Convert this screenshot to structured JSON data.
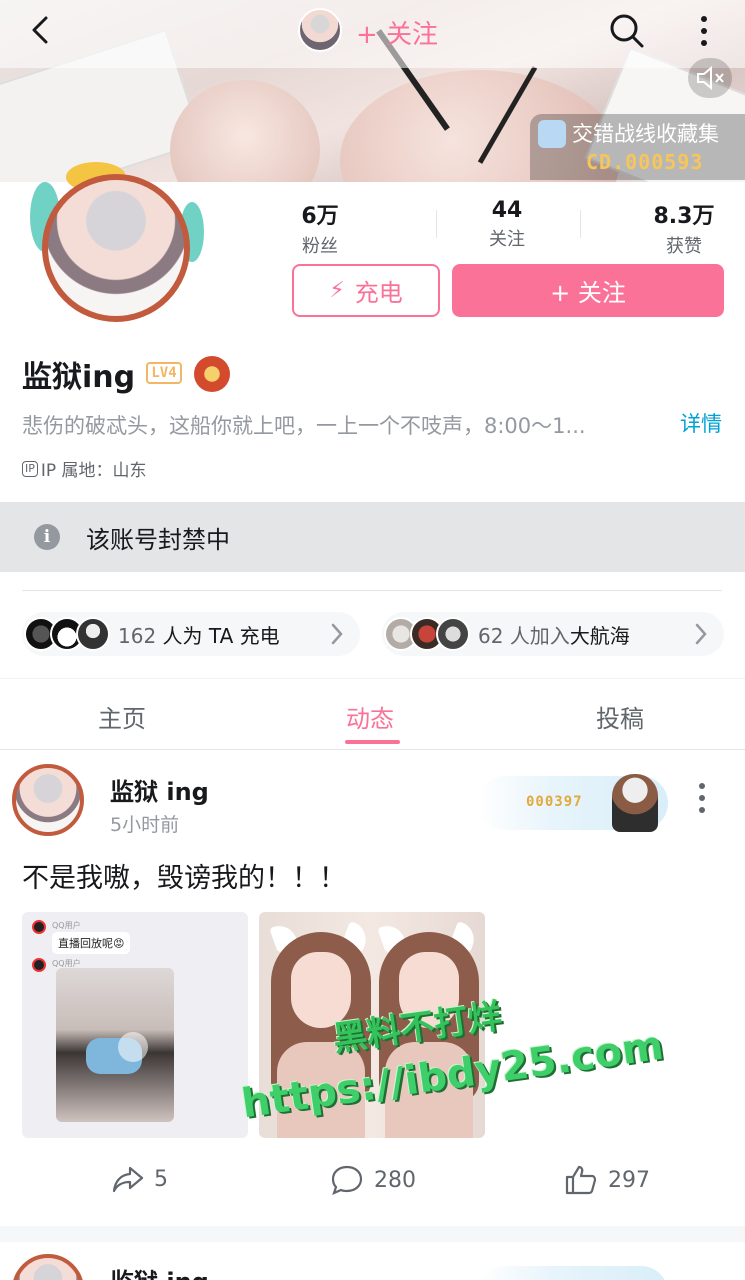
{
  "header": {
    "top_follow_label": "+ 关注",
    "collection_name": "交错战线收藏集",
    "collection_no": "CD.000593"
  },
  "profile": {
    "stats": [
      {
        "value": "6万",
        "label": "粉丝"
      },
      {
        "value": "44",
        "label": "关注"
      },
      {
        "value": "8.3万",
        "label": "获赞"
      }
    ],
    "charge_label": "充电",
    "follow_label": "+ 关注",
    "username": "监狱ing",
    "level": "LV4",
    "bio": "悲伤的破忒头，这船你就上吧，一上一个不吱声，8:00～1...",
    "detail_label": "详情",
    "ip_icon": "IP",
    "ip_text": "IP 属地：山东"
  },
  "ban_notice": {
    "icon": "i",
    "text": "该账号封禁中"
  },
  "supporters": {
    "charge": {
      "count": "162",
      "text": "人为 TA 充电"
    },
    "fleet": {
      "count": "62",
      "text": "人加入",
      "highlight": "大航海"
    }
  },
  "tabs": [
    {
      "label": "主页"
    },
    {
      "label": "动态"
    },
    {
      "label": "投稿"
    }
  ],
  "post": {
    "author": "监狱 ing",
    "time": "5小时前",
    "fan_no": "000397",
    "text": "不是我嗷，毁谤我的！！！",
    "qq_name": "QQ用户",
    "qq_bubble": "直播回放呢😡",
    "watermark_line1": "黑料不打烊",
    "watermark_line2": "https://ibdy25.com",
    "shares": "5",
    "comments": "280",
    "likes": "297"
  },
  "post2": {
    "author": "监狱 ing"
  },
  "colors": {
    "accent": "#fb7299",
    "link": "#00a1d6",
    "ban_bg": "#e3e5e7"
  }
}
